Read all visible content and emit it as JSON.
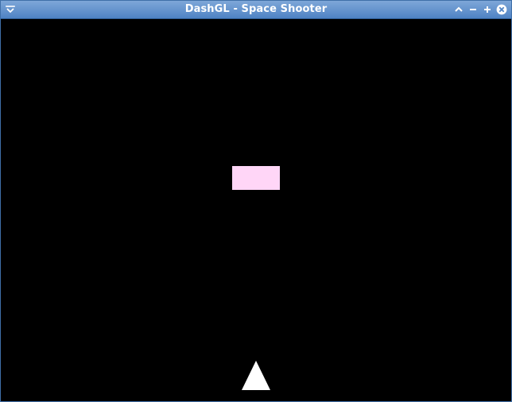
{
  "window": {
    "title": "DashGL - Space Shooter"
  },
  "icons": {
    "menu": "chevron-down-menu-icon",
    "shade": "chevron-up-icon",
    "minimize": "minus-icon",
    "maximize": "plus-icon",
    "close": "close-icon"
  },
  "colors": {
    "titlebar_top": "#7ea7d8",
    "titlebar_bottom": "#4f83c4",
    "canvas_bg": "#000000",
    "enemy": "#ffd6f7",
    "player_ship": "#ffffff"
  },
  "game": {
    "enemy_count": 1,
    "player_ship_count": 1
  }
}
